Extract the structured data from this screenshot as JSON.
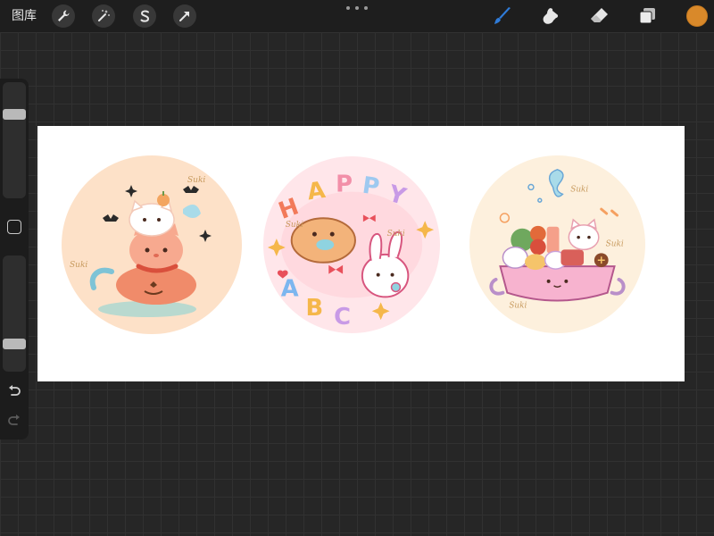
{
  "toolbar": {
    "gallery_label": "图库",
    "left_tools": [
      "wrench-icon",
      "magic-wand-icon",
      "selection-s-icon",
      "arrow-transform-icon"
    ],
    "right_tools": [
      "brush-icon",
      "smudge-icon",
      "eraser-icon",
      "layers-icon"
    ],
    "active_tool": "brush-icon",
    "brush_color": "#2f7bd8",
    "current_color": "#d9892a"
  },
  "sidebar": {
    "size_slider_level": 0.75,
    "opacity_slider_level": 0.21
  },
  "canvas": {
    "background": "#ffffff",
    "stickers": [
      {
        "name": "halloween-cats-sticker",
        "background": "#fde1c8",
        "watermark": "Suki"
      },
      {
        "name": "happy-abc-sticker",
        "background": "#ffe6ea",
        "watermark": "Suki",
        "letters": [
          "H",
          "A",
          "P",
          "P",
          "Y",
          "A",
          "B",
          "C"
        ]
      },
      {
        "name": "hotpot-sticker",
        "background": "#fdf0dd",
        "watermark": "Suki"
      }
    ]
  }
}
